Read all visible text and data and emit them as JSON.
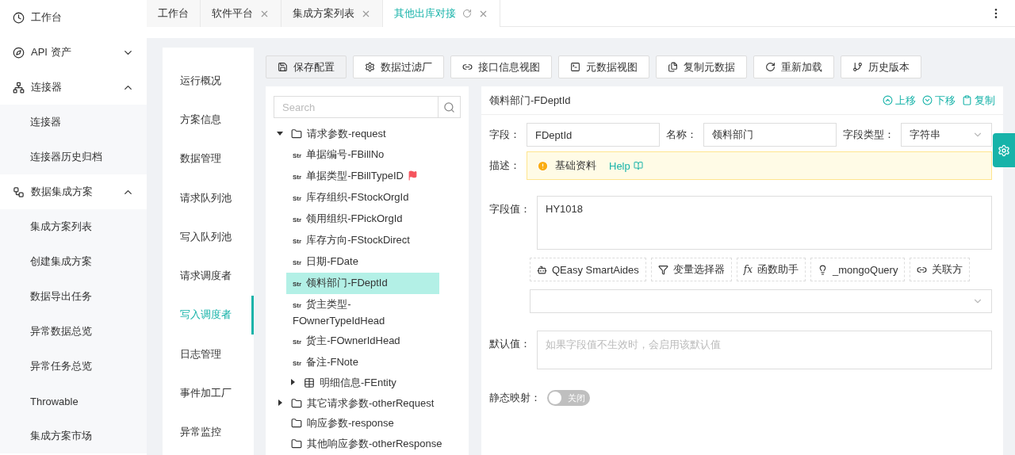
{
  "sidebar": {
    "items": [
      {
        "label": "工作台"
      },
      {
        "label": "API 资产",
        "expanded": false
      },
      {
        "label": "连接器",
        "expanded": true,
        "children": [
          {
            "label": "连接器"
          },
          {
            "label": "连接器历史归档"
          }
        ]
      },
      {
        "label": "数据集成方案",
        "expanded": true,
        "children": [
          {
            "label": "集成方案列表"
          },
          {
            "label": "创建集成方案"
          },
          {
            "label": "数据导出任务"
          },
          {
            "label": "异常数据总览"
          },
          {
            "label": "异常任务总览"
          },
          {
            "label": "Throwable"
          },
          {
            "label": "集成方案市场"
          }
        ]
      }
    ]
  },
  "tabs": [
    {
      "label": "工作台",
      "selected": false,
      "closable": false
    },
    {
      "label": "软件平台",
      "selected": false,
      "closable": true
    },
    {
      "label": "集成方案列表",
      "selected": false,
      "closable": true
    },
    {
      "label": "其他出库对接",
      "selected": true,
      "closable": true
    }
  ],
  "sub_nav": {
    "items": [
      {
        "label": "运行概况",
        "selected": false
      },
      {
        "label": "方案信息",
        "selected": false
      },
      {
        "label": "数据管理",
        "selected": false
      },
      {
        "label": "请求队列池",
        "selected": false
      },
      {
        "label": "写入队列池",
        "selected": false
      },
      {
        "label": "请求调度者",
        "selected": false
      },
      {
        "label": "写入调度者",
        "selected": true
      },
      {
        "label": "日志管理",
        "selected": false
      },
      {
        "label": "事件加工厂",
        "selected": false
      },
      {
        "label": "异常监控",
        "selected": false
      }
    ]
  },
  "toolbar": [
    "保存配置",
    "数据过滤厂",
    "接口信息视图",
    "元数据视图",
    "复制元数据",
    "重新加载",
    "历史版本"
  ],
  "tree": {
    "search": {
      "placeholder": "Search"
    },
    "items": [
      {
        "kind": "folder",
        "label": "请求参数-request",
        "expanded": true,
        "children": [
          {
            "kind": "string",
            "type_label": "Str",
            "label": "单据编号-FBillNo",
            "flagged": false,
            "selected": false
          },
          {
            "kind": "string",
            "type_label": "Str",
            "label": "单据类型-FBillTypeID",
            "flagged": true,
            "selected": false
          },
          {
            "kind": "string",
            "type_label": "Str",
            "label": "库存组织-FStockOrgId",
            "flagged": false,
            "selected": false
          },
          {
            "kind": "string",
            "type_label": "Str",
            "label": "领用组织-FPickOrgId",
            "flagged": false,
            "selected": false
          },
          {
            "kind": "string",
            "type_label": "Str",
            "label": "库存方向-FStockDirect",
            "flagged": false,
            "selected": false
          },
          {
            "kind": "string",
            "type_label": "Str",
            "label": "日期-FDate",
            "flagged": false,
            "selected": false
          },
          {
            "kind": "string",
            "type_label": "Str",
            "label": "领料部门-FDeptId",
            "flagged": false,
            "selected": true
          },
          {
            "kind": "string",
            "type_label": "Str",
            "label": "货主类型-FOwnerTypeIdHead",
            "flagged": false,
            "selected": false
          },
          {
            "kind": "string",
            "type_label": "Str",
            "label": "货主-FOwnerIdHead",
            "flagged": false,
            "selected": false
          },
          {
            "kind": "string",
            "type_label": "Str",
            "label": "备注-FNote",
            "flagged": false,
            "selected": false
          },
          {
            "kind": "table",
            "label": "明细信息-FEntity",
            "expanded": false
          }
        ]
      },
      {
        "kind": "folder",
        "label": "其它请求参数-otherRequest",
        "expanded": false
      },
      {
        "kind": "folder",
        "label": "响应参数-response"
      },
      {
        "kind": "folder",
        "label": "其他响应参数-otherResponse"
      }
    ]
  },
  "detail": {
    "title": "领料部门-FDeptId",
    "actions": [
      "上移",
      "下移",
      "复制"
    ],
    "field": {
      "label": "字段：",
      "value": "FDeptId"
    },
    "name": {
      "label": "名称：",
      "value": "领料部门"
    },
    "type": {
      "label": "字段类型：",
      "value": "字符串"
    },
    "description": {
      "label": "描述：",
      "text": "基础资料",
      "link": "Help"
    },
    "field_value": {
      "label": "字段值：",
      "value": "HY1018"
    },
    "helpers": [
      {
        "label": "QEasy SmartAides"
      },
      {
        "label": "变量选择器"
      },
      {
        "label": "函数助手",
        "symbol": "fx"
      },
      {
        "label": "_mongoQuery"
      },
      {
        "label": "关联方"
      }
    ],
    "default_value": {
      "label": "默认值：",
      "placeholder": "如果字段值不生效时，会启用该默认值"
    },
    "static_mapping": {
      "label": "静态映射：",
      "on": false,
      "text": "关闭"
    }
  }
}
